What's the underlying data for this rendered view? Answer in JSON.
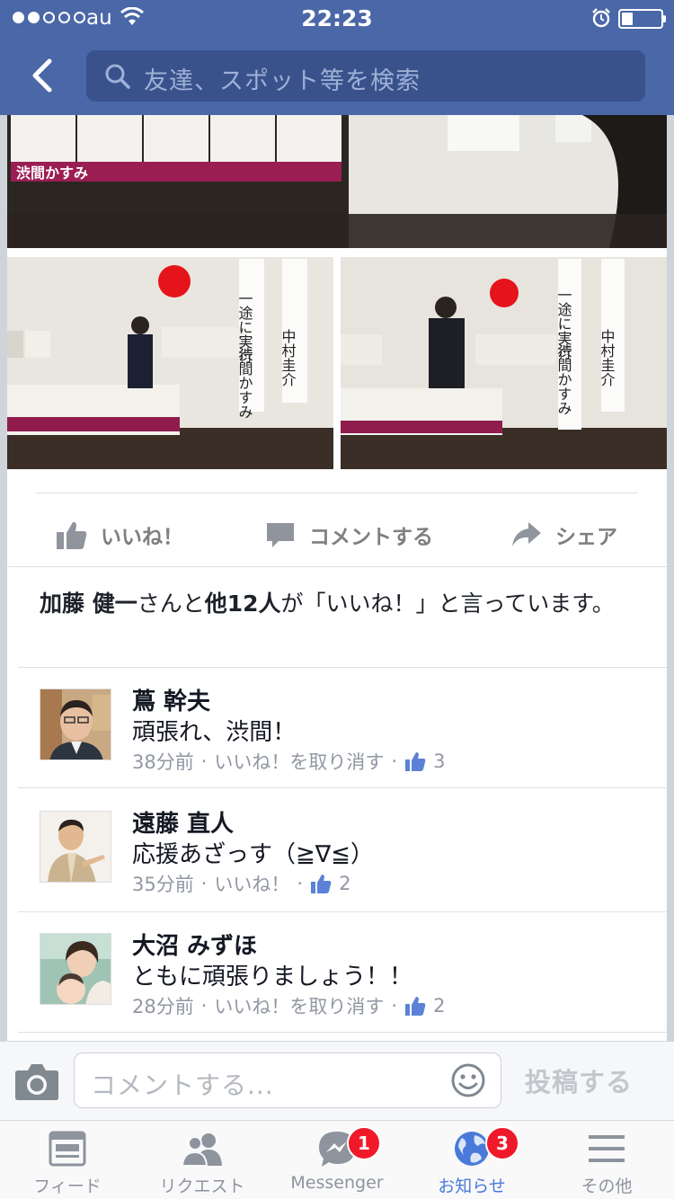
{
  "status_bar": {
    "carrier": "au",
    "time": "22:23"
  },
  "header": {
    "search_placeholder": "友達、スポット等を検索"
  },
  "post": {
    "photos": [
      {
        "poster_name": "渋間かすみ"
      },
      {
        "banner_1": "一途に実行",
        "banner_2": "渋間かすみ",
        "banner_3": "中村圭介"
      },
      {
        "banner_1": "一途に実行",
        "banner_2": "渋間かすみ",
        "banner_3": "中村圭介"
      }
    ],
    "actions": {
      "like": "いいね！",
      "comment": "コメントする",
      "share": "シェア"
    },
    "likes_summary": {
      "name": "加藤 健一",
      "middle": "さんと",
      "others": "他12人",
      "suffix": "が「いいね！」と言っています。"
    }
  },
  "comments": [
    {
      "name": "蔦 幹夫",
      "text": "頑張れ、渋間！",
      "time": "38分前",
      "action": "いいね！を取り消す",
      "likes": "3"
    },
    {
      "name": "遠藤 直人",
      "text": "応援あざっす（≧∇≦）",
      "time": "35分前",
      "action": "いいね！",
      "likes": "2"
    },
    {
      "name": "大沼 みずほ",
      "text": "ともに頑張りましょう！！",
      "time": "28分前",
      "action": "いいね！を取り消す",
      "likes": "2"
    }
  ],
  "composer": {
    "placeholder": "コメントする...",
    "post_label": "投稿する"
  },
  "tabbar": [
    {
      "label": "フィード",
      "icon": "feed-icon"
    },
    {
      "label": "リクエスト",
      "icon": "friend-requests-icon"
    },
    {
      "label": "Messenger",
      "icon": "messenger-icon",
      "badge": "1"
    },
    {
      "label": "お知らせ",
      "icon": "globe-icon",
      "badge": "3",
      "active": true
    },
    {
      "label": "その他",
      "icon": "menu-icon"
    }
  ],
  "colors": {
    "header": "#4a67a7",
    "active_tab": "#4a7ad9",
    "badge": "#f0192a"
  }
}
